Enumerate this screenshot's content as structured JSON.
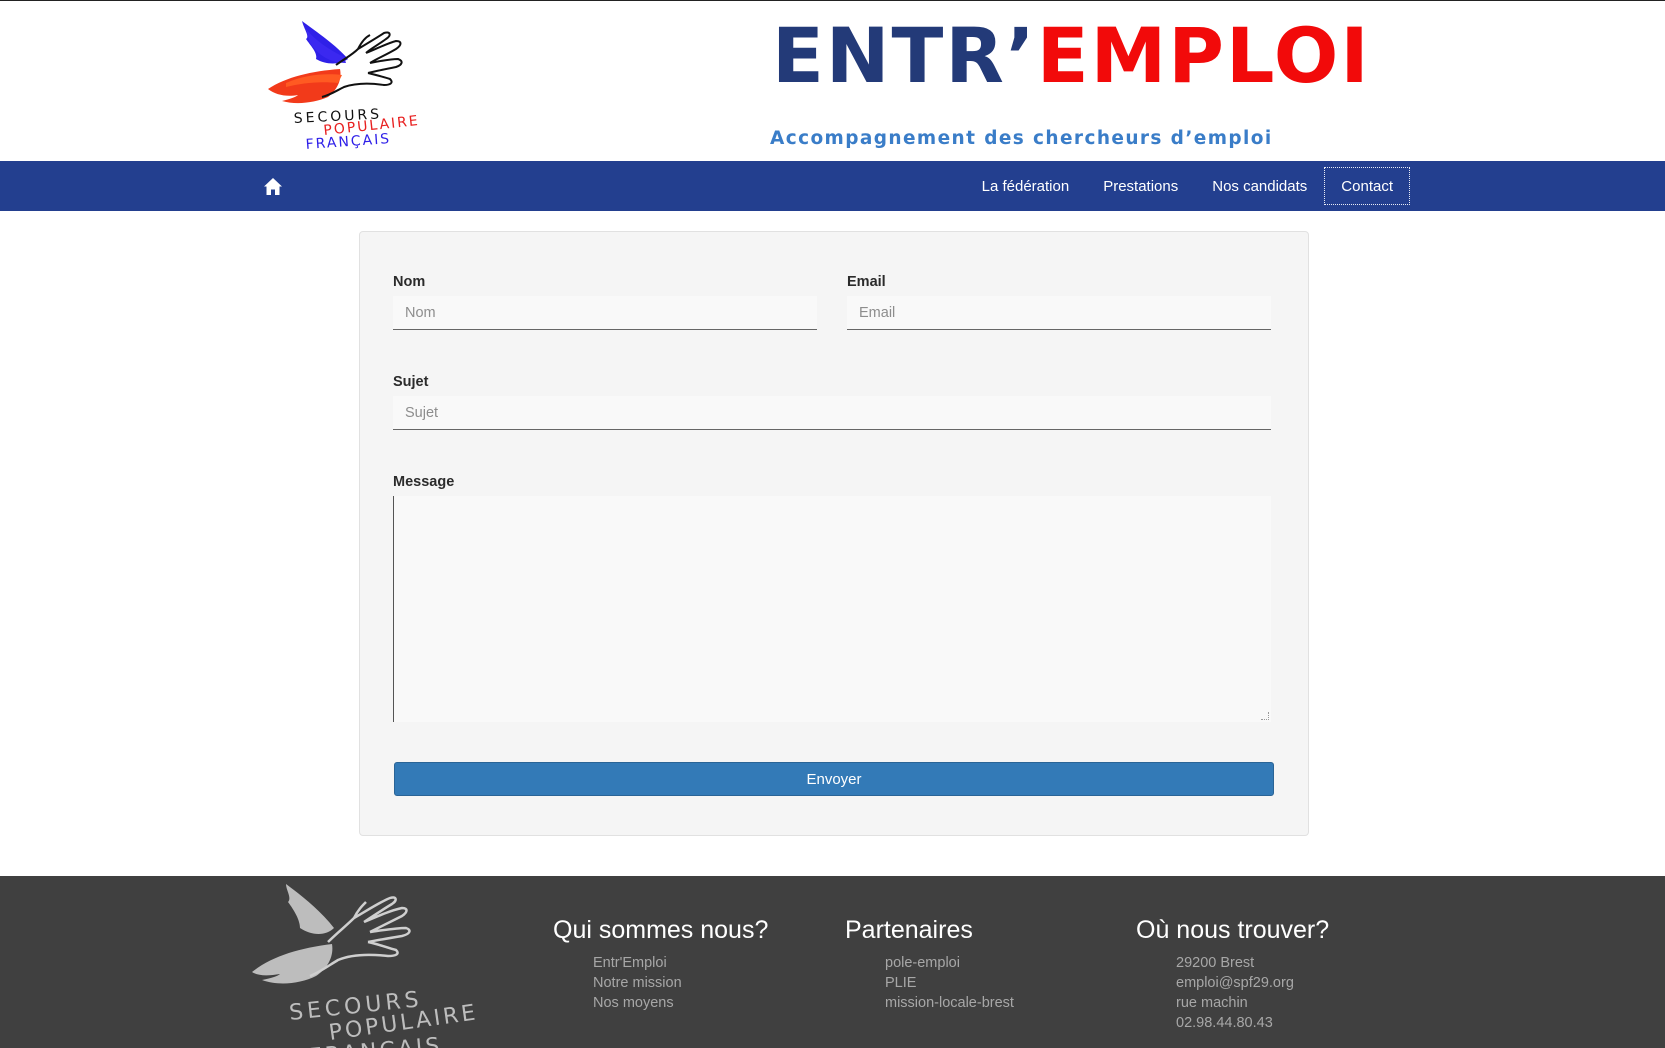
{
  "header": {
    "logo_alt": "Secours Populaire Français",
    "logo_text": [
      "SECOURS",
      "POPULAIRE",
      "FRANÇAIS"
    ],
    "brand_part1": "ENTR’",
    "brand_part2": "EMPLOI",
    "tagline": "Accompagnement des chercheurs d’emploi",
    "colors": {
      "brand_blue": "#233a78",
      "brand_red": "#f20a0a",
      "tagline": "#3a7dc8"
    }
  },
  "navbar": {
    "home_icon": "home-icon",
    "items": [
      {
        "label": "La fédération"
      },
      {
        "label": "Prestations"
      },
      {
        "label": "Nos candidats"
      },
      {
        "label": "Contact",
        "active": true
      }
    ],
    "background": "#233f8f"
  },
  "form": {
    "nom": {
      "label": "Nom",
      "placeholder": "Nom",
      "value": ""
    },
    "email": {
      "label": "Email",
      "placeholder": "Email",
      "value": ""
    },
    "sujet": {
      "label": "Sujet",
      "placeholder": "Sujet",
      "value": ""
    },
    "message": {
      "label": "Message",
      "value": ""
    },
    "submit_label": "Envoyer",
    "button_color": "#337ab7"
  },
  "footer": {
    "logo_text": [
      "SECOURS",
      "POPULAIRE",
      "FRANÇAIS"
    ],
    "columns": [
      {
        "title": "Qui sommes nous?",
        "items": [
          "Entr'Emploi",
          "Notre mission",
          "Nos moyens"
        ]
      },
      {
        "title": "Partenaires",
        "items": [
          "pole-emploi",
          "PLIE",
          "mission-locale-brest"
        ]
      },
      {
        "title": "Où nous trouver?",
        "items": [
          "29200 Brest",
          "emploi@spf29.org",
          "rue machin",
          "02.98.44.80.43"
        ]
      }
    ],
    "background": "#404040"
  }
}
